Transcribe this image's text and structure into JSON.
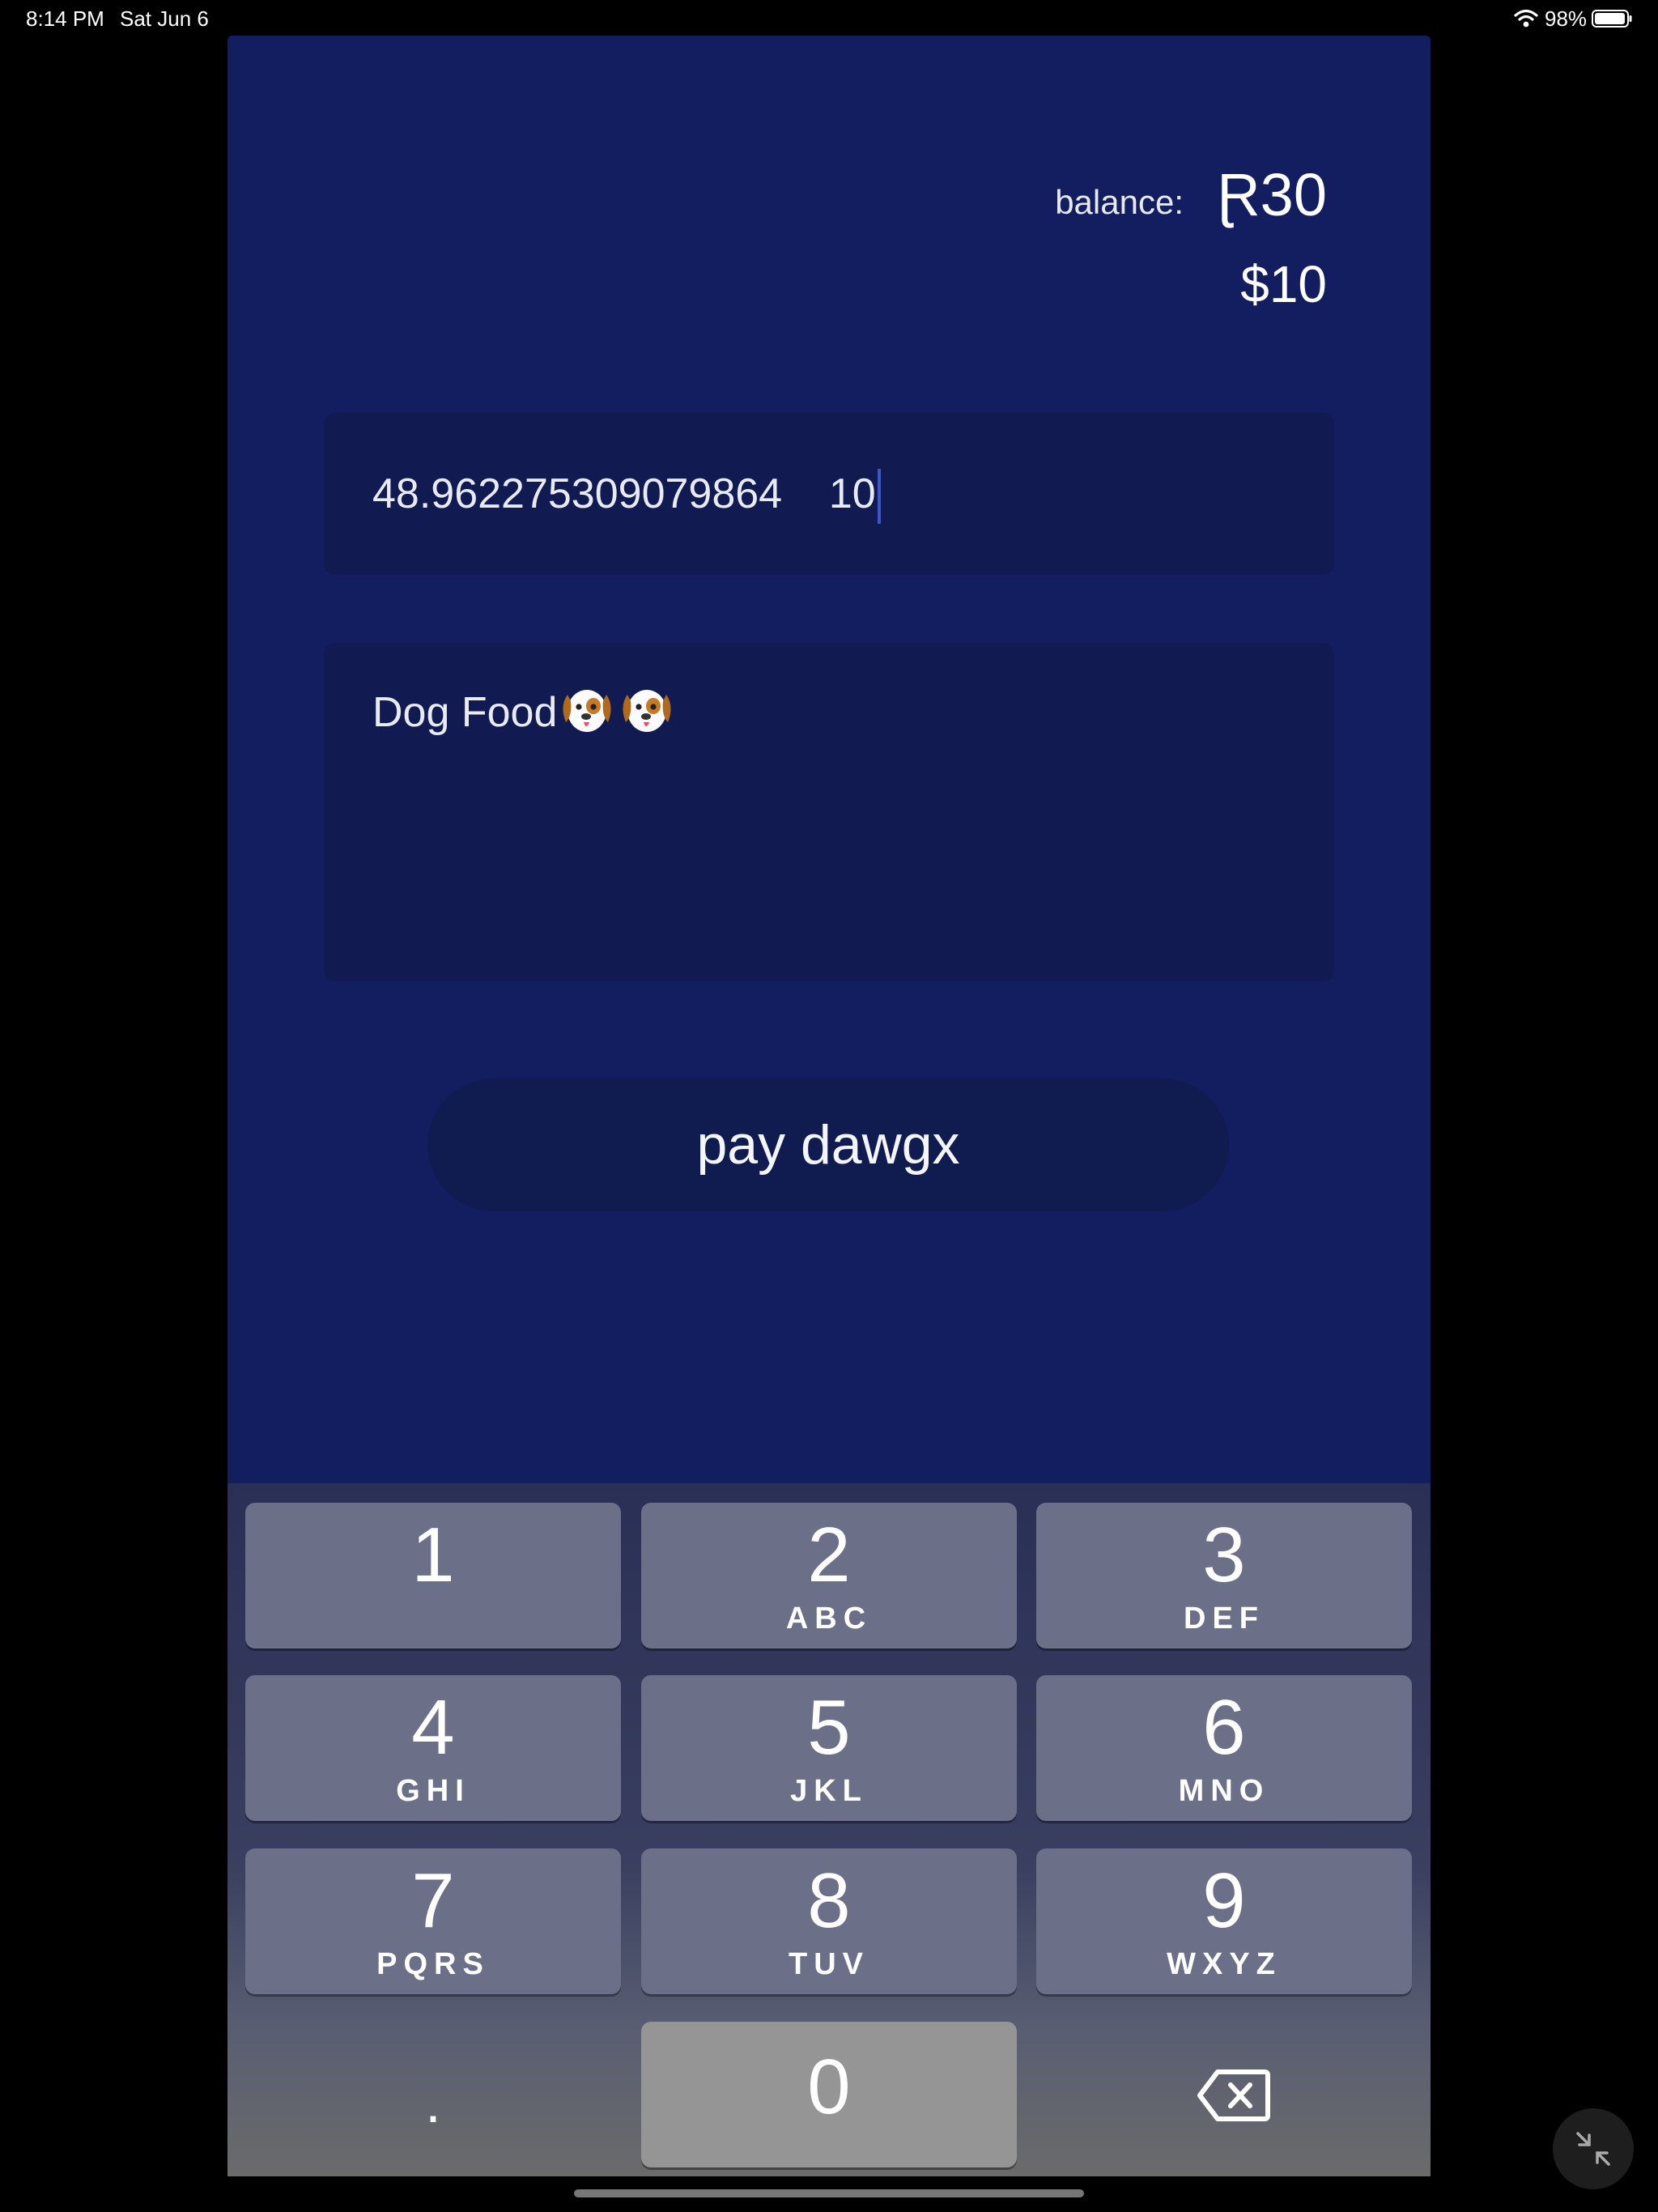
{
  "status_bar": {
    "time": "8:14 PM",
    "date": "Sat Jun 6",
    "battery": "98%"
  },
  "balance": {
    "label": "balance:",
    "rand": "Ɽ30",
    "usd": "$10"
  },
  "amount_field": {
    "rand_value": "48.962275309079864",
    "usd_value": "10"
  },
  "memo_field": {
    "text": "Dog Food",
    "emoji_icons": [
      "dog-face-icon",
      "dog-face-icon"
    ]
  },
  "pay_button": {
    "label": "pay dawgx"
  },
  "keypad": {
    "keys": [
      {
        "digit": "1",
        "letters": ""
      },
      {
        "digit": "2",
        "letters": "ABC"
      },
      {
        "digit": "3",
        "letters": "DEF"
      },
      {
        "digit": "4",
        "letters": "GHI"
      },
      {
        "digit": "5",
        "letters": "JKL"
      },
      {
        "digit": "6",
        "letters": "MNO"
      },
      {
        "digit": "7",
        "letters": "PQRS"
      },
      {
        "digit": "8",
        "letters": "TUV"
      },
      {
        "digit": "9",
        "letters": "WXYZ"
      },
      {
        "digit": "0",
        "letters": ""
      }
    ],
    "decimal": ".",
    "delete_icon": "backspace-icon"
  },
  "colors": {
    "app_background": "#121e5f",
    "field_background": "#111b52",
    "key_background": "#6b6f87"
  }
}
